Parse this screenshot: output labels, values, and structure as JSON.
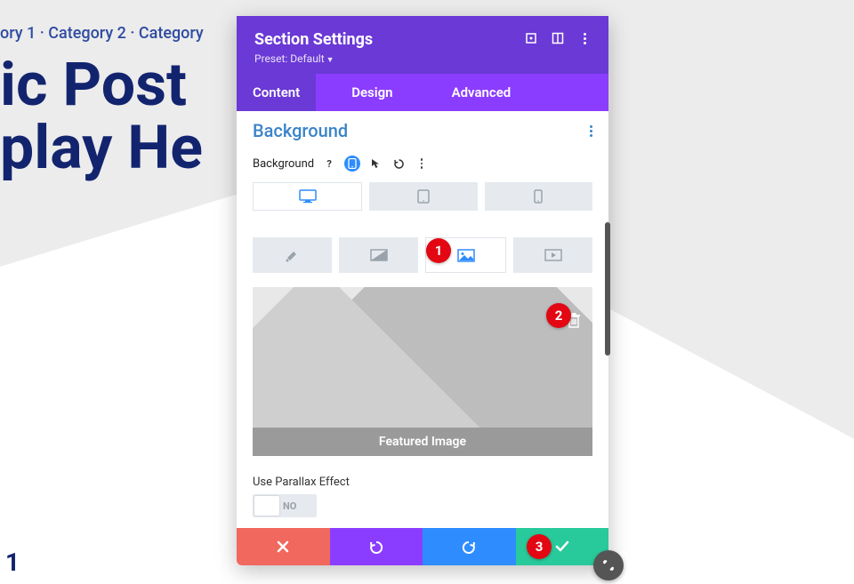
{
  "background_page": {
    "meta": "ory 1 · Category 2 · Category",
    "title_line1": "ic Post",
    "title_line2": "play He",
    "heading1": "1"
  },
  "panel": {
    "header": {
      "title": "Section Settings",
      "preset": "Preset: Default"
    },
    "tabs": [
      {
        "label": "Content",
        "active": true
      },
      {
        "label": "Design",
        "active": false
      },
      {
        "label": "Advanced",
        "active": false
      }
    ],
    "section": {
      "title": "Background",
      "field_label": "Background"
    },
    "image_preview": {
      "caption": "Featured Image"
    },
    "parallax": {
      "label": "Use Parallax Effect",
      "value_label": "NO"
    }
  },
  "callouts": {
    "one": "1",
    "two": "2",
    "three": "3"
  }
}
